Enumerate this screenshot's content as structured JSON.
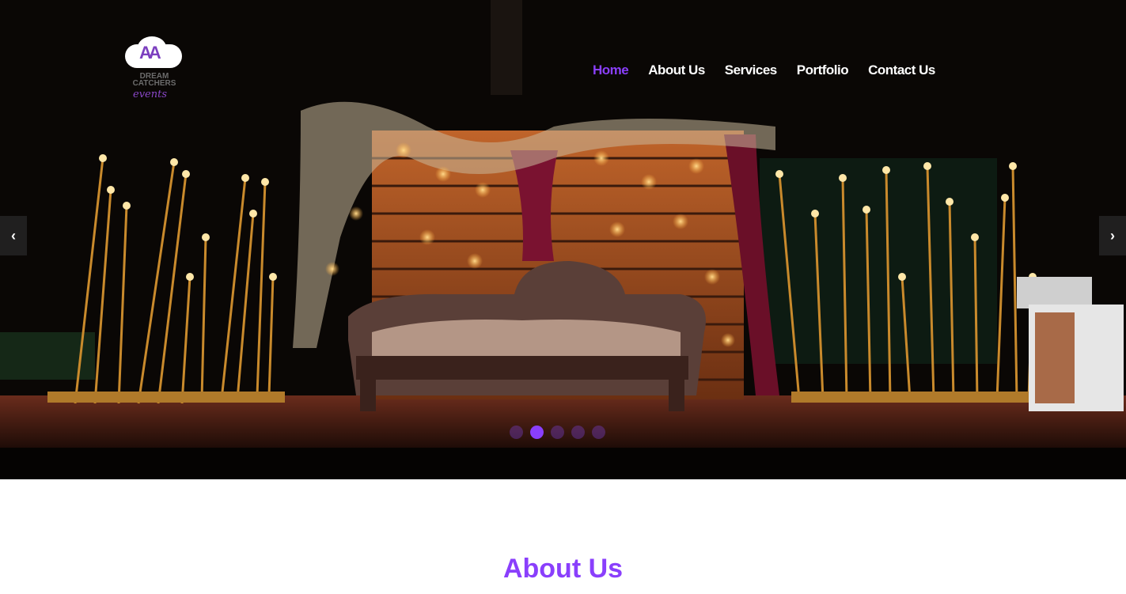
{
  "logo": {
    "mark": "AA",
    "name": "DREAM CATCHERS",
    "script": "events"
  },
  "nav": [
    {
      "label": "Home",
      "active": true
    },
    {
      "label": "About Us",
      "active": false
    },
    {
      "label": "Services",
      "active": false
    },
    {
      "label": "Portfolio",
      "active": false
    },
    {
      "label": "Contact Us",
      "active": false
    }
  ],
  "slider": {
    "prev_icon": "chevron-left-icon",
    "next_icon": "chevron-right-icon",
    "prev_glyph": "‹",
    "next_glyph": "›",
    "slide_count": 5,
    "active_slide": 2
  },
  "about": {
    "title": "About Us"
  },
  "colors": {
    "accent": "#8a3ffc"
  }
}
